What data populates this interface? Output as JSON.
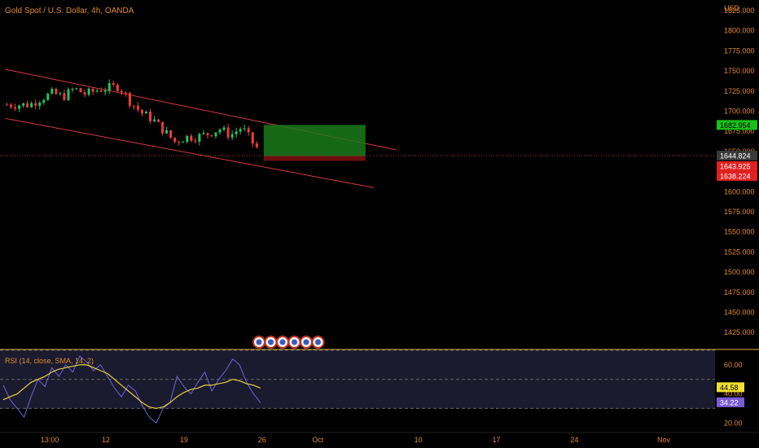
{
  "header": {
    "symbol_title": "Gold Spot / U.S. Dollar, 4h, OANDA",
    "currency": "USD"
  },
  "colors": {
    "background": "#000000",
    "text_orange": "#e08a2a",
    "channel_line": "#d23a3a",
    "candle_up": "#22c55e",
    "candle_down": "#ef3b3b",
    "profit_zone": "#1a7a1a",
    "loss_zone": "#7a1010",
    "rsi_line": "#6e63d6",
    "rsi_sma": "#e6d23a",
    "rsi_band": "#1b1b2f",
    "separator": "#e0b446"
  },
  "chart_data": [
    {
      "type": "candlestick",
      "title": "Gold Spot / U.S. Dollar, 4h, OANDA",
      "ylabel": "USD",
      "ylim": [
        1405,
        1830
      ],
      "y_ticks": [
        "1825.000",
        "1800.000",
        "1775.000",
        "1750.000",
        "1725.000",
        "1700.000",
        "1675.000",
        "1650.000",
        "1625.000",
        "1600.000",
        "1575.000",
        "1550.000",
        "1525.000",
        "1500.000",
        "1475.000",
        "1450.000",
        "1425.000"
      ],
      "x_ticks": [
        "13:00",
        "12",
        "19",
        "26",
        "Oct",
        "10",
        "17",
        "24",
        "Nov"
      ],
      "close_path": [
        [
          "Sep 05",
          1708
        ],
        [
          "Sep 06",
          1716
        ],
        [
          "Sep 07",
          1722
        ],
        [
          "Sep 08",
          1718
        ],
        [
          "Sep 09",
          1728
        ],
        [
          "Sep 10",
          1721
        ],
        [
          "Sep 11",
          1726
        ],
        [
          "Sep 12",
          1729
        ],
        [
          "Sep 13",
          1731
        ],
        [
          "Sep 14",
          1712
        ],
        [
          "Sep 15",
          1698
        ],
        [
          "Sep 16",
          1690
        ],
        [
          "Sep 17",
          1676
        ],
        [
          "Sep 18",
          1662
        ],
        [
          "Sep 19",
          1668
        ],
        [
          "Sep 20",
          1668
        ],
        [
          "Sep 21",
          1672
        ],
        [
          "Sep 22",
          1678
        ],
        [
          "Sep 23",
          1670
        ],
        [
          "Sep 24",
          1680
        ],
        [
          "Sep 25",
          1660
        ],
        [
          "Sep 26",
          1644
        ]
      ],
      "channel": {
        "upper": [
          [
            "Sep 03",
            1752
          ],
          [
            "Oct 08",
            1652
          ]
        ],
        "lower": [
          [
            "Sep 03",
            1691
          ],
          [
            "Oct 06",
            1605
          ]
        ]
      },
      "position": {
        "profit_top": 1682.954,
        "entry": 1643.925,
        "stop": 1638.224,
        "start": "Sep 26",
        "end": "Oct 06"
      },
      "price_labels": {
        "target": "1682.954",
        "last": "1644.824",
        "entry": "1643.925",
        "stop": "1638.224"
      },
      "event_icons": 6
    },
    {
      "type": "line",
      "title": "RSI (14, close, SMA, 14, 2)",
      "ylim": [
        14,
        70
      ],
      "y_ticks": [
        "60.00",
        "40.00",
        "20.00"
      ],
      "bands": [
        70,
        30
      ],
      "series": [
        {
          "name": "RSI",
          "values": [
            46,
            36,
            30,
            24,
            38,
            50,
            45,
            58,
            52,
            60,
            55,
            66,
            62,
            56,
            60,
            52,
            44,
            38,
            46,
            42,
            32,
            24,
            20,
            30,
            34,
            52,
            45,
            40,
            48,
            55,
            42,
            50,
            56,
            64,
            60,
            48,
            40,
            34
          ]
        },
        {
          "name": "SMA",
          "values": [
            36,
            38,
            40,
            44,
            48,
            50,
            52,
            55,
            57,
            58,
            59,
            60,
            60,
            58,
            56,
            54,
            50,
            46,
            42,
            38,
            34,
            31,
            30,
            31,
            34,
            38,
            41,
            43,
            44,
            46,
            46,
            47,
            48,
            50,
            49,
            47,
            46,
            44
          ]
        }
      ],
      "value_labels": {
        "sma": "44.58",
        "rsi": "34.22"
      }
    }
  ]
}
